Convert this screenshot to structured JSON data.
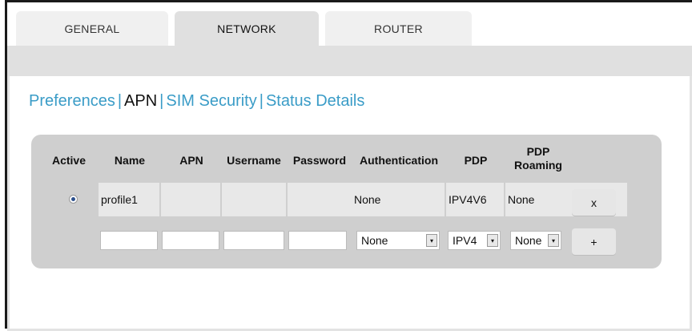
{
  "tabs": [
    {
      "label": "GENERAL"
    },
    {
      "label": "NETWORK"
    },
    {
      "label": "ROUTER"
    }
  ],
  "subnav": {
    "preferences": "Preferences",
    "apn": "APN",
    "sim_security": "SIM Security",
    "status_details": "Status Details",
    "separator": "|"
  },
  "table": {
    "headers": {
      "active": "Active",
      "name": "Name",
      "apn": "APN",
      "username": "Username",
      "password": "Password",
      "authentication": "Authentication",
      "pdp": "PDP",
      "pdp_roaming": "PDP Roaming"
    },
    "rows": [
      {
        "active": true,
        "name": "profile1",
        "apn": "",
        "username": "",
        "password": "",
        "authentication": "None",
        "pdp": "IPV4V6",
        "pdp_roaming": "None",
        "delete_label": "x"
      }
    ],
    "new_row": {
      "authentication": "None",
      "pdp": "IPV4",
      "pdp_roaming": "None",
      "add_label": "+"
    }
  },
  "icons": {
    "dropdown_arrow": "▾",
    "radio": "radio-selected"
  },
  "colors": {
    "link": "#3a9cc7",
    "panel": "#cfcfcf",
    "cell": "#e8e8e8",
    "tab_active": "#e0e0e0"
  }
}
